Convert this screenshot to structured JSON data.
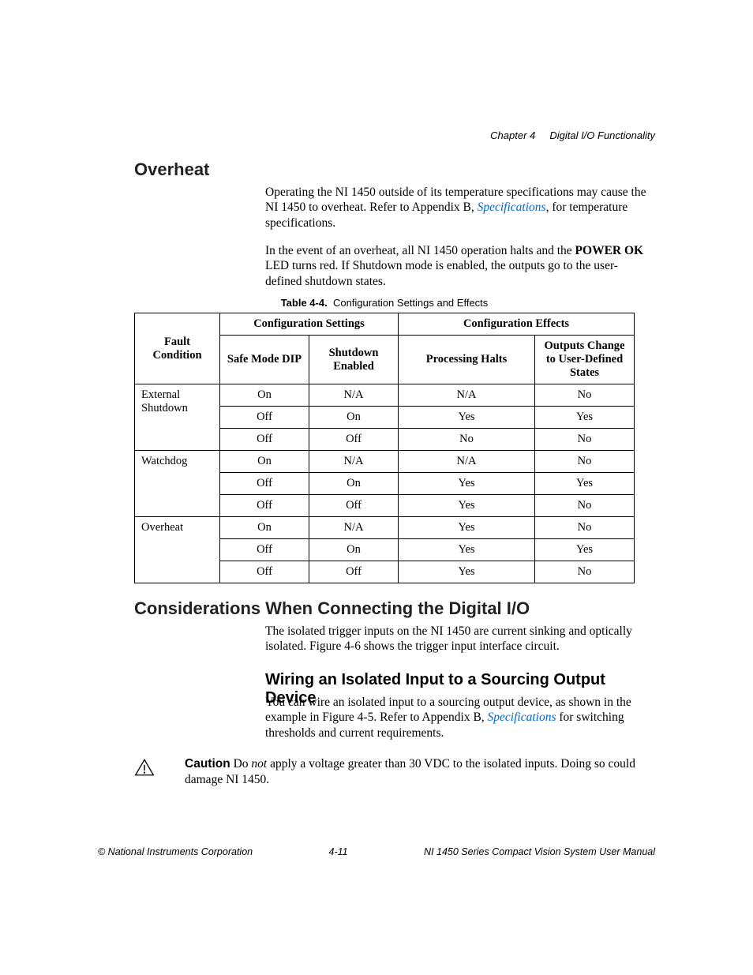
{
  "header": {
    "chapter": "Chapter 4",
    "title": "Digital I/O Functionality"
  },
  "section1": {
    "heading": "Overheat",
    "p1_a": "Operating the NI 1450 outside of its temperature specifications may cause the NI 1450 to overheat. Refer to Appendix B, ",
    "p1_link": "Specifications",
    "p1_b": ", for temperature specifications.",
    "p2_a": "In the event of an overheat, all NI 1450 operation halts and the ",
    "p2_bold": "POWER OK",
    "p2_b": " LED turns red. If Shutdown mode is enabled, the outputs go to the user-defined shutdown states."
  },
  "table": {
    "caption_label": "Table 4-4.",
    "caption_text": "Configuration Settings and Effects",
    "headers": {
      "fault": "Fault Condition",
      "settings": "Configuration Settings",
      "effects": "Configuration Effects",
      "safe": "Safe Mode DIP",
      "shutdown": "Shutdown Enabled",
      "proc": "Processing Halts",
      "outputs": "Outputs Change to User-Defined States"
    },
    "rows": [
      {
        "fault": "External Shutdown",
        "safe": "On",
        "shutdown": "N/A",
        "proc": "N/A",
        "out": "No"
      },
      {
        "fault": "",
        "safe": "Off",
        "shutdown": "On",
        "proc": "Yes",
        "out": "Yes"
      },
      {
        "fault": "",
        "safe": "Off",
        "shutdown": "Off",
        "proc": "No",
        "out": "No"
      },
      {
        "fault": "Watchdog",
        "safe": "On",
        "shutdown": "N/A",
        "proc": "N/A",
        "out": "No"
      },
      {
        "fault": "",
        "safe": "Off",
        "shutdown": "On",
        "proc": "Yes",
        "out": "Yes"
      },
      {
        "fault": "",
        "safe": "Off",
        "shutdown": "Off",
        "proc": "Yes",
        "out": "No"
      },
      {
        "fault": "Overheat",
        "safe": "On",
        "shutdown": "N/A",
        "proc": "Yes",
        "out": "No"
      },
      {
        "fault": "",
        "safe": "Off",
        "shutdown": "On",
        "proc": "Yes",
        "out": "Yes"
      },
      {
        "fault": "",
        "safe": "Off",
        "shutdown": "Off",
        "proc": "Yes",
        "out": "No"
      }
    ]
  },
  "section2": {
    "heading": "Considerations When Connecting the Digital I/O",
    "p1": "The isolated trigger inputs on the NI 1450 are current sinking and optically isolated. Figure 4-6 shows the trigger input interface circuit."
  },
  "section3": {
    "heading": "Wiring an Isolated Input to a Sourcing Output Device",
    "p1_a": "You can wire an isolated input to a sourcing output device, as shown in the example in Figure 4-5. Refer to Appendix B, ",
    "p1_link": "Specifications",
    "p1_b": " for switching thresholds and current requirements."
  },
  "caution": {
    "label": "Caution",
    "text_a": "   Do ",
    "text_ital": "not",
    "text_b": " apply a voltage greater than 30 VDC to the isolated inputs. Doing so could damage NI 1450."
  },
  "footer": {
    "left": "© National Instruments Corporation",
    "center": "4-11",
    "right": "NI 1450 Series Compact Vision System User Manual"
  }
}
